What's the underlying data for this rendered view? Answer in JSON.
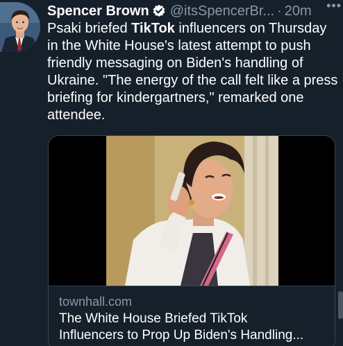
{
  "tweet": {
    "author_name": "Spencer Brown",
    "handle": "@itsSpencerBr...",
    "separator": "·",
    "time": "20m",
    "more_label": "•••",
    "text_before": "Psaki briefed ",
    "text_bold": "TikTok",
    "text_after": " influencers on Thursday in the White House's latest attempt to push friendly messaging on Biden's handling of Ukraine. \"The energy of the call felt like a press briefing for kindergartners,\" remarked one attendee."
  },
  "card": {
    "domain": "townhall.com",
    "title_line1": "The White House Briefed TikTok",
    "title_line2": "Influencers to Prop Up Biden's Handling..."
  },
  "colors": {
    "background": "#15202b",
    "secondary_text": "#8b98a5",
    "verified": "#1d9bf0",
    "border": "#38444d"
  },
  "icons": {
    "verified": "verified-badge-icon",
    "more": "more-options-icon"
  }
}
